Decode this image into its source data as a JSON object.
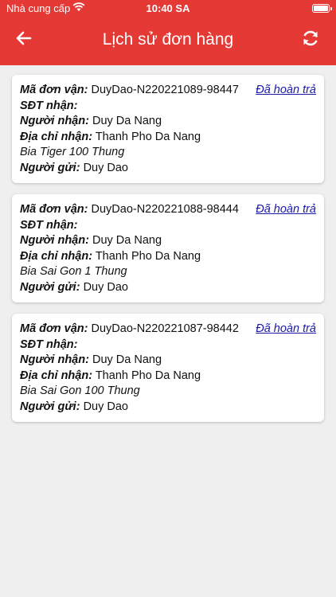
{
  "status_bar": {
    "carrier": "Nhà cung cấp",
    "time": "10:40 SA"
  },
  "header": {
    "title": "Lịch sử đơn hàng",
    "back_icon": "arrow-left-icon",
    "refresh_icon": "refresh-icon",
    "color": "#e53935"
  },
  "labels": {
    "order_code": "Mã đơn vận:",
    "phone": "SĐT nhận:",
    "receiver": "Người nhận:",
    "address": "Địa chỉ nhận:",
    "sender": "Người gửi:"
  },
  "orders": [
    {
      "code": "DuyDao-N220221089-98447",
      "status": "Đã hoàn trả",
      "phone": "",
      "receiver": "Duy Da Nang",
      "address": "Thanh Pho Da Nang",
      "item": "Bia Tiger 100 Thung",
      "sender": "Duy Dao"
    },
    {
      "code": "DuyDao-N220221088-98444",
      "status": "Đã hoàn trả",
      "phone": "",
      "receiver": "Duy Da Nang",
      "address": "Thanh Pho Da Nang",
      "item": "Bia Sai Gon 1 Thung",
      "sender": "Duy Dao"
    },
    {
      "code": "DuyDao-N220221087-98442",
      "status": "Đã hoàn trả",
      "phone": "",
      "receiver": "Duy Da Nang",
      "address": "Thanh Pho Da Nang",
      "item": "Bia Sai Gon 100 Thung",
      "sender": "Duy Dao"
    }
  ]
}
